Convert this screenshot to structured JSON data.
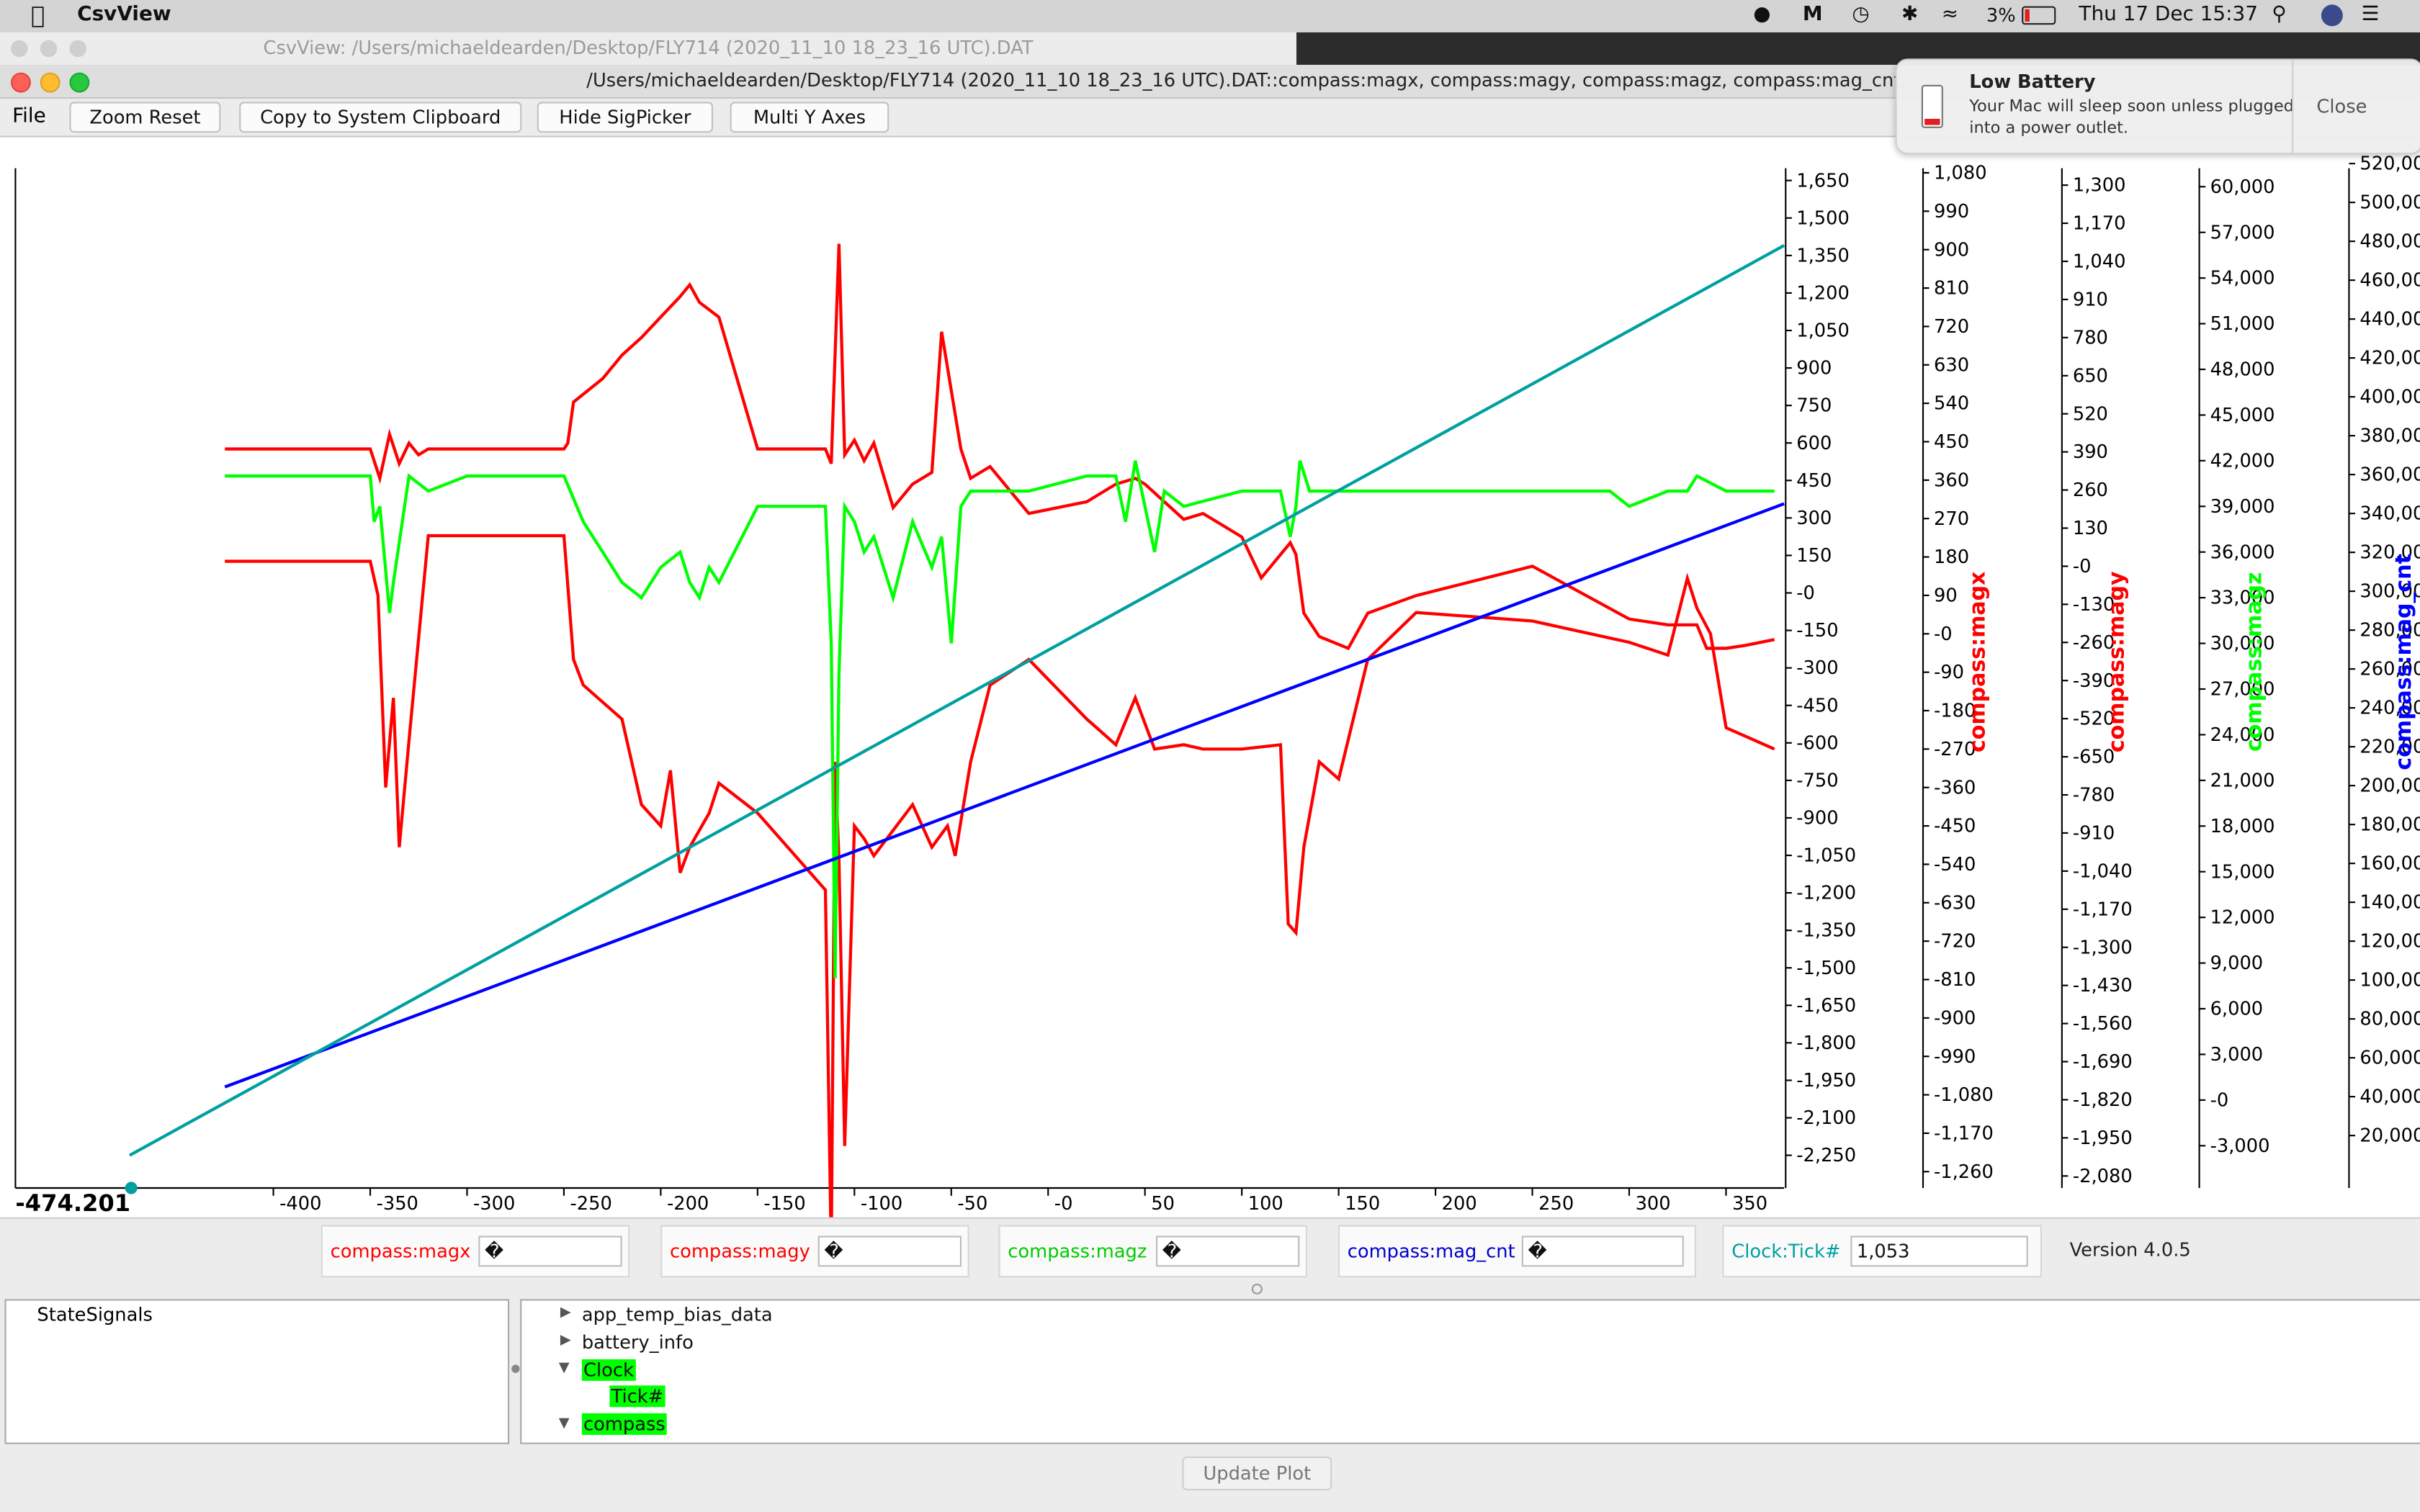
{
  "menubar": {
    "app_name": "CsvView",
    "battery_percent": "3%",
    "datetime": "Thu 17 Dec  15:37"
  },
  "window": {
    "background_title": "CsvView: /Users/michaeldearden/Desktop/FLY714 (2020_11_10 18_23_16 UTC).DAT",
    "title": "/Users/michaeldearden/Desktop/FLY714 (2020_11_10 18_23_16 UTC).DAT::compass:magx, compass:magy, compass:magz, compass:mag_cnt, Clock:Tic"
  },
  "toolbar": {
    "file_menu": "File",
    "zoom_reset": "Zoom Reset",
    "copy_clipboard": "Copy to System Clipboard",
    "hide_sigpicker": "Hide SigPicker",
    "multi_y_axes": "Multi Y Axes"
  },
  "notification": {
    "title": "Low Battery",
    "body_line1": "Your Mac will sleep soon unless plugged",
    "body_line2": "into a power outlet.",
    "close_label": "Close"
  },
  "chart_data": {
    "type": "line",
    "cursor_readout": "-474.201",
    "x_ticks": [
      "-400",
      "-350",
      "-300",
      "-250",
      "-200",
      "-150",
      "-100",
      "-50",
      "-0",
      "50",
      "100",
      "150",
      "200",
      "250",
      "300",
      "350"
    ],
    "x_tick_values": [
      -400,
      -350,
      -300,
      -250,
      -200,
      -150,
      -100,
      -50,
      0,
      50,
      100,
      150,
      200,
      250,
      300,
      350
    ],
    "xlim": [
      -474.201,
      380
    ],
    "axes": [
      {
        "label": "",
        "color": "#000000",
        "ticks": [
          "1,650",
          "1,500",
          "1,350",
          "1,200",
          "1,050",
          "900",
          "750",
          "600",
          "450",
          "300",
          "150",
          "-0",
          "-150",
          "-300",
          "-450",
          "-600",
          "-750",
          "-900",
          "-1,050",
          "-1,200",
          "-1,350",
          "-1,500",
          "-1,650",
          "-1,800",
          "-1,950",
          "-2,100",
          "-2,250"
        ]
      },
      {
        "label": "compass:magx",
        "color": "#ff0000",
        "ticks": [
          "1,080",
          "990",
          "900",
          "810",
          "720",
          "630",
          "540",
          "450",
          "360",
          "270",
          "180",
          "90",
          "-0",
          "-90",
          "-180",
          "-270",
          "-360",
          "-450",
          "-540",
          "-630",
          "-720",
          "-810",
          "-900",
          "-990",
          "-1,080",
          "-1,170",
          "-1,260"
        ]
      },
      {
        "label": "compass:magy",
        "color": "#ff0000",
        "ticks": [
          "1,300",
          "1,170",
          "1,040",
          "910",
          "780",
          "650",
          "520",
          "390",
          "260",
          "130",
          "-0",
          "-130",
          "-260",
          "-390",
          "-520",
          "-650",
          "-780",
          "-910",
          "-1,040",
          "-1,170",
          "-1,300",
          "-1,430",
          "-1,560",
          "-1,690",
          "-1,820",
          "-1,950",
          "-2,080"
        ]
      },
      {
        "label": "compass:magz",
        "color": "#00ff00",
        "ticks": [
          "60,000",
          "57,000",
          "54,000",
          "51,000",
          "48,000",
          "45,000",
          "42,000",
          "39,000",
          "36,000",
          "33,000",
          "30,000",
          "27,000",
          "24,000",
          "21,000",
          "18,000",
          "15,000",
          "12,000",
          "9,000",
          "6,000",
          "3,000",
          "-0",
          "-3,000"
        ]
      },
      {
        "label": "compass:mag_cnt",
        "color": "#0000ff",
        "ticks": [
          "520,00",
          "500,00",
          "480,00",
          "460,00",
          "440,00",
          "420,00",
          "400,00",
          "380,00",
          "360,00",
          "340,00",
          "320,00",
          "300,00",
          "280,00",
          "260,00",
          "240,00",
          "220,00",
          "200,00",
          "180,00",
          "160,00",
          "140,00",
          "120,00",
          "100,00",
          "80,000",
          "60,000",
          "40,000",
          "20,000"
        ]
      }
    ],
    "series": [
      {
        "name": "compass:magx",
        "color": "#ff0000",
        "x": [
          -425,
          -350,
          -346,
          -342,
          -338,
          -335,
          -330,
          -320,
          -300,
          -250,
          -245,
          -240,
          -220,
          -210,
          -200,
          -195,
          -190,
          -185,
          -175,
          -170,
          -150,
          -115,
          -112,
          -110,
          -108,
          -105,
          -100,
          -95,
          -90,
          -70,
          -60,
          -52,
          -48,
          -40,
          -30,
          -10,
          20,
          35,
          45,
          55,
          70,
          80,
          100,
          120,
          124,
          128,
          132,
          140,
          150,
          165,
          190,
          250,
          300,
          320,
          330,
          335,
          342,
          350,
          360,
          375
        ],
        "y": [
          170,
          170,
          90,
          -360,
          -150,
          -500,
          -250,
          230,
          230,
          230,
          -60,
          -120,
          -200,
          -400,
          -450,
          -320,
          -560,
          -500,
          -420,
          -350,
          -420,
          -600,
          -1450,
          -300,
          -530,
          -1200,
          -450,
          -480,
          -520,
          -400,
          -500,
          -450,
          -520,
          -300,
          -120,
          -60,
          -200,
          -260,
          -150,
          -270,
          -260,
          -270,
          -270,
          -260,
          -680,
          -700,
          -500,
          -300,
          -340,
          -60,
          50,
          30,
          -20,
          -50,
          130,
          60,
          0,
          -220,
          -240,
          -270
        ]
      },
      {
        "name": "compass:magy",
        "color": "#ff0000",
        "x": [
          -425,
          -350,
          -345,
          -340,
          -335,
          -330,
          -325,
          -320,
          -300,
          -250,
          -248,
          -245,
          -230,
          -220,
          -210,
          -200,
          -190,
          -185,
          -180,
          -170,
          -150,
          -115,
          -112,
          -108,
          -105,
          -100,
          -95,
          -90,
          -80,
          -70,
          -60,
          -55,
          -45,
          -40,
          -30,
          -10,
          20,
          35,
          45,
          50,
          60,
          70,
          80,
          100,
          110,
          125,
          128,
          132,
          140,
          155,
          165,
          190,
          250,
          300,
          320,
          335,
          340,
          350,
          360,
          375
        ],
        "y": [
          400,
          400,
          300,
          450,
          350,
          420,
          380,
          400,
          400,
          400,
          420,
          560,
          640,
          720,
          780,
          850,
          920,
          960,
          900,
          850,
          400,
          400,
          350,
          1100,
          380,
          430,
          360,
          420,
          200,
          280,
          320,
          800,
          400,
          300,
          340,
          180,
          220,
          280,
          300,
          280,
          220,
          160,
          180,
          100,
          -40,
          80,
          40,
          -160,
          -240,
          -280,
          -160,
          -100,
          0,
          -180,
          -200,
          -200,
          -280,
          -280,
          -270,
          -250
        ]
      },
      {
        "name": "compass:magz",
        "color": "#00ff00",
        "x": [
          -425,
          -350,
          -348,
          -345,
          -340,
          -338,
          -330,
          -320,
          -300,
          -250,
          -240,
          -230,
          -220,
          -210,
          -200,
          -190,
          -185,
          -180,
          -175,
          -170,
          -150,
          -115,
          -112,
          -110,
          -108,
          -105,
          -100,
          -95,
          -90,
          -80,
          -70,
          -60,
          -55,
          -50,
          -45,
          -40,
          -30,
          -10,
          20,
          35,
          40,
          45,
          55,
          60,
          70,
          100,
          120,
          125,
          128,
          130,
          135,
          150,
          200,
          250,
          290,
          300,
          320,
          330,
          335,
          350,
          360,
          375
        ],
        "y": [
          41000,
          41000,
          38000,
          39000,
          32000,
          34000,
          41000,
          40000,
          41000,
          41000,
          38000,
          36000,
          34000,
          33000,
          35000,
          36000,
          34000,
          33000,
          35000,
          34000,
          39000,
          39000,
          30000,
          8000,
          28000,
          39000,
          38000,
          36000,
          37000,
          33000,
          38000,
          35000,
          37000,
          30000,
          39000,
          40000,
          40000,
          40000,
          41000,
          41000,
          38000,
          42000,
          36000,
          40000,
          39000,
          40000,
          40000,
          37000,
          39000,
          42000,
          40000,
          40000,
          40000,
          40000,
          40000,
          39000,
          40000,
          40000,
          41000,
          40000,
          40000,
          40000
        ]
      },
      {
        "name": "compass:mag_cnt",
        "color": "#0000ff",
        "x": [
          -425,
          380
        ],
        "y": [
          45000,
          345000
        ]
      },
      {
        "name": "Clock:Tick#",
        "color": "#00a0a0",
        "x": [
          -474.201,
          380
        ],
        "y": [
          -2250,
          1390
        ]
      }
    ]
  },
  "signals": [
    {
      "label": "compass:magx",
      "value": "�",
      "color": "#ff0000"
    },
    {
      "label": "compass:magy",
      "value": "�",
      "color": "#ff0000"
    },
    {
      "label": "compass:magz",
      "value": "�",
      "color": "#00cc00"
    },
    {
      "label": "compass:mag_cnt",
      "value": "�",
      "color": "#0000cc"
    },
    {
      "label": "Clock:Tick#",
      "value": "1,053",
      "color": "#00a0a0"
    }
  ],
  "version": "Version 4.0.5",
  "state_panel": {
    "title": "StateSignals"
  },
  "tree": {
    "items": [
      {
        "label": "app_temp_bias_data"
      },
      {
        "label": "battery_info"
      },
      {
        "label": "Clock"
      },
      {
        "label": "Tick#"
      },
      {
        "label": "compass"
      }
    ]
  },
  "update_button": "Update Plot"
}
